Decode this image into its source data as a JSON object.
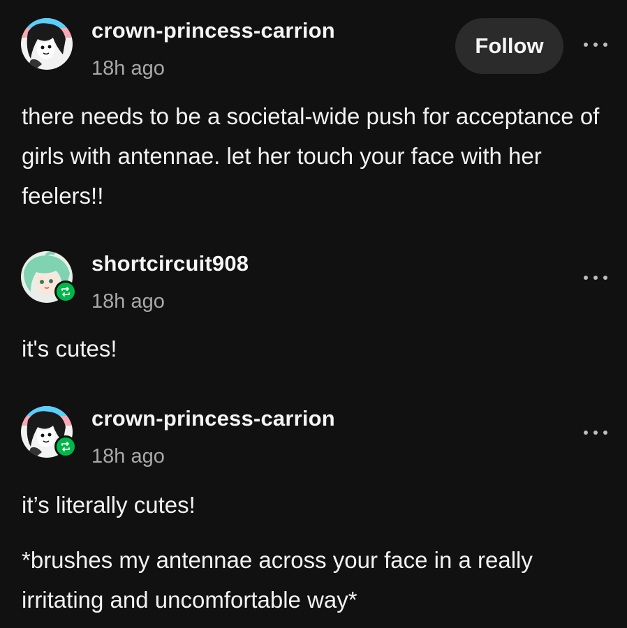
{
  "posts": [
    {
      "username": "crown-princess-carrion",
      "time": "18h ago",
      "follow_label": "Follow",
      "body": [
        "there needs to be a societal-wide push for acceptance of girls with antennae. let her touch your face with her feelers!!"
      ]
    },
    {
      "username": "shortcircuit908",
      "time": "18h ago",
      "body": [
        "it's cutes!"
      ]
    },
    {
      "username": "crown-princess-carrion",
      "time": "18h ago",
      "body": [
        "it’s literally cutes!",
        "*brushes my antennae across your face in a really irritating and uncomfortable way*"
      ]
    }
  ],
  "colors": {
    "background": "#111111",
    "reblog_badge": "#00b84a",
    "follow_button_bg": "#2b2b2b"
  },
  "icons": {
    "more": "ellipsis-icon",
    "reblog": "reblog-icon"
  }
}
